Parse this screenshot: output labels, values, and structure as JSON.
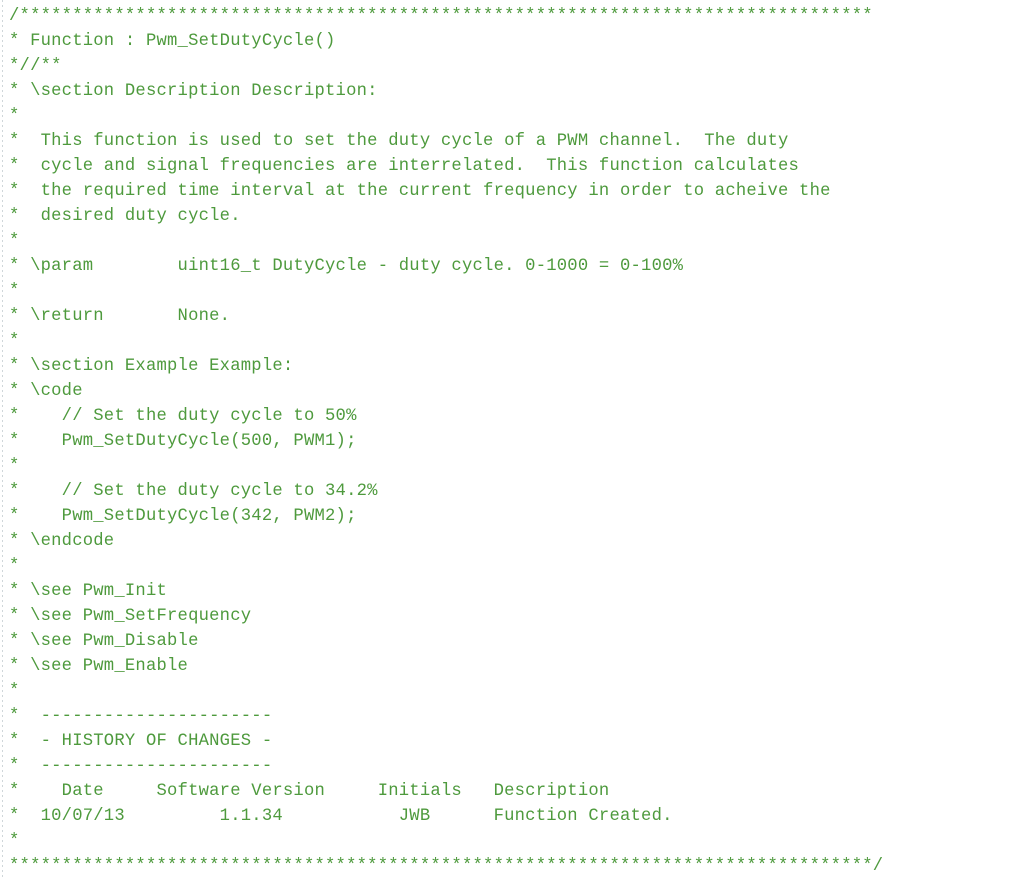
{
  "document": {
    "kind": "source-code-comment-block",
    "language": "C",
    "style": "doxygen",
    "font_color": "#4e9a3d",
    "background_color": "#ffffff",
    "columns": 83,
    "line_count": 35
  },
  "banner": {
    "top": "/*********************************************************************************",
    "bottom": "**********************************************************************************/"
  },
  "header": {
    "function_line": "* Function : Pwm_SetDutyCycle()",
    "doxygen_open": "*//**"
  },
  "sections": {
    "description_heading": "* \\section Description Description:",
    "example_heading": "* \\section Example Example:",
    "code_open": "* \\code",
    "code_close": "* \\endcode"
  },
  "description": {
    "lines": [
      "*  This function is used to set the duty cycle of a PWM channel.  The duty",
      "*  cycle and signal frequencies are interrelated.  This function calculates",
      "*  the required time interval at the current frequency in order to acheive the",
      "*  desired duty cycle."
    ]
  },
  "tags": {
    "param": "* \\param        uint16_t DutyCycle - duty cycle. 0-1000 = 0-100%",
    "return": "* \\return       None."
  },
  "example": {
    "lines": [
      "*    // Set the duty cycle to 50%",
      "*    Pwm_SetDutyCycle(500, PWM1);",
      "*",
      "*    // Set the duty cycle to 34.2%",
      "*    Pwm_SetDutyCycle(342, PWM2);"
    ]
  },
  "see_also": {
    "lines": [
      "* \\see Pwm_Init",
      "* \\see Pwm_SetFrequency",
      "* \\see Pwm_Disable",
      "* \\see Pwm_Enable"
    ]
  },
  "history": {
    "rule": "*  ----------------------",
    "title": "*  - HISTORY OF CHANGES -",
    "header_row": "*    Date     Software Version     Initials   Description",
    "entries": [
      "*  10/07/13         1.1.34           JWB      Function Created."
    ]
  },
  "blank": "*",
  "lines": [
    "/*********************************************************************************",
    "* Function : Pwm_SetDutyCycle()",
    "*//**",
    "* \\section Description Description:",
    "*",
    "*  This function is used to set the duty cycle of a PWM channel.  The duty",
    "*  cycle and signal frequencies are interrelated.  This function calculates",
    "*  the required time interval at the current frequency in order to acheive the",
    "*  desired duty cycle.",
    "*",
    "* \\param        uint16_t DutyCycle - duty cycle. 0-1000 = 0-100%",
    "*",
    "* \\return       None.",
    "*",
    "* \\section Example Example:",
    "* \\code",
    "*    // Set the duty cycle to 50%",
    "*    Pwm_SetDutyCycle(500, PWM1);",
    "*",
    "*    // Set the duty cycle to 34.2%",
    "*    Pwm_SetDutyCycle(342, PWM2);",
    "* \\endcode",
    "*",
    "* \\see Pwm_Init",
    "* \\see Pwm_SetFrequency",
    "* \\see Pwm_Disable",
    "* \\see Pwm_Enable",
    "*",
    "*  ----------------------",
    "*  - HISTORY OF CHANGES -",
    "*  ----------------------",
    "*    Date     Software Version     Initials   Description",
    "*  10/07/13         1.1.34           JWB      Function Created.",
    "*",
    "**********************************************************************************/"
  ]
}
